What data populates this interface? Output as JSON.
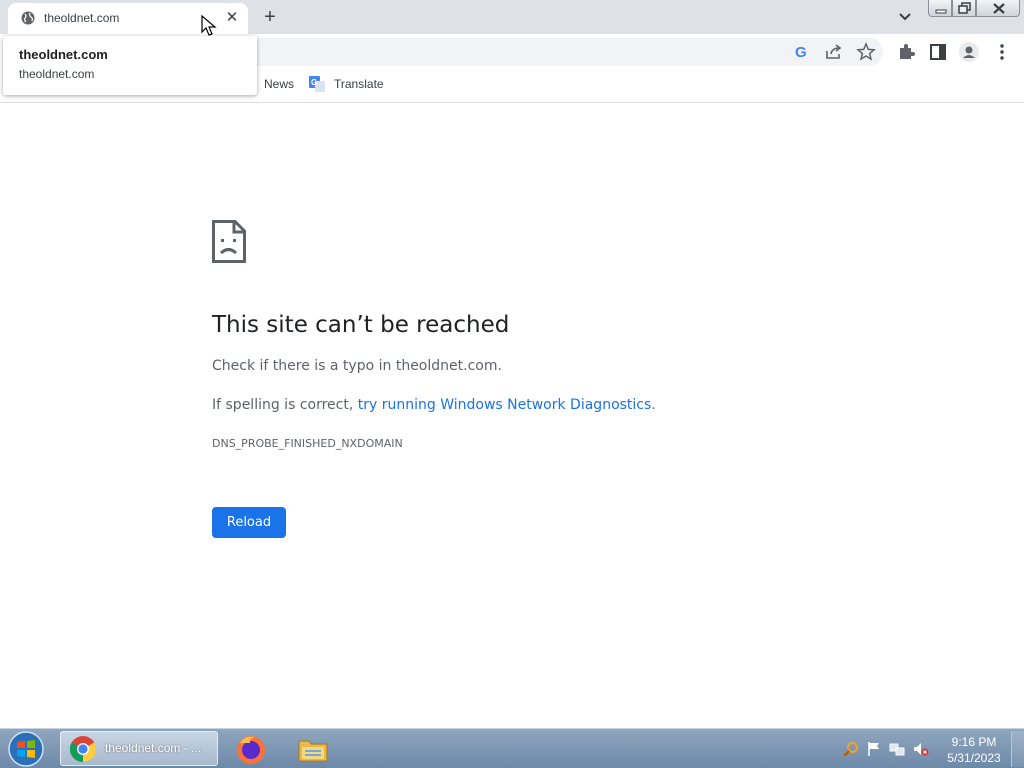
{
  "browser": {
    "tab": {
      "title": "theoldnet.com",
      "close_label": "✕"
    },
    "new_tab_label": "+",
    "hover_card": {
      "title": "theoldnet.com",
      "domain": "theoldnet.com"
    },
    "bookmarks": [
      {
        "label": "News"
      },
      {
        "label": "Translate"
      }
    ]
  },
  "error_page": {
    "title": "This site can’t be reached",
    "line1": "Check if there is a typo in theoldnet.com.",
    "line2_prefix": "If spelling is correct, ",
    "line2_link": "try running Windows Network Diagnostics",
    "line2_suffix": ".",
    "error_code": "DNS_PROBE_FINISHED_NXDOMAIN",
    "reload_label": "Reload"
  },
  "taskbar": {
    "chrome_label": "theoldnet.com - ...",
    "clock_time": "9:16 PM",
    "clock_date": "5/31/2023"
  },
  "colors": {
    "accent": "#1a73e8",
    "tabstrip": "#dee1e6",
    "text_primary": "#202124",
    "text_secondary": "#5f6368"
  }
}
